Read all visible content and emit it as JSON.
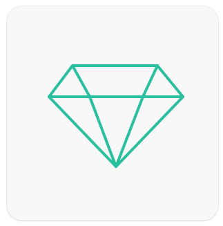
{
  "app_icon": {
    "icon_name": "diamond-icon",
    "stroke_color": "#2BBFA0",
    "background_color": "#F8F8F8"
  }
}
